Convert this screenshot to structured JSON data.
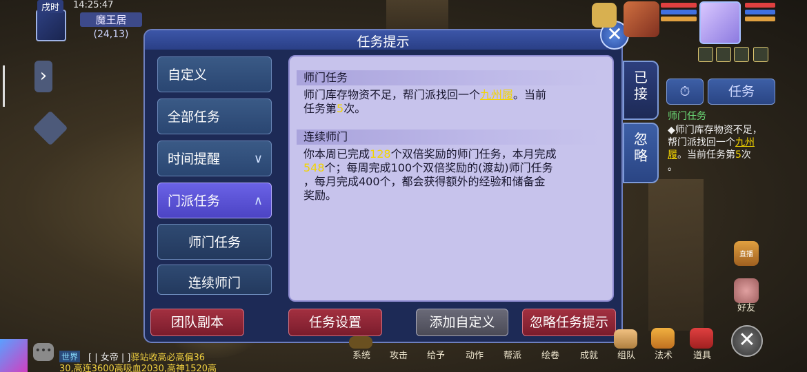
{
  "location": {
    "time_period": "戌时",
    "clock": "14:25:47",
    "map_name": "魔王居",
    "coordinates": "(24,13)"
  },
  "dialog": {
    "title": "任务提示",
    "close_glyph": "✕"
  },
  "menu": {
    "items": [
      {
        "label": "自定义",
        "chevron": ""
      },
      {
        "label": "全部任务",
        "chevron": ""
      },
      {
        "label": "时间提醒",
        "chevron": "∨"
      },
      {
        "label": "门派任务",
        "chevron": "∧"
      },
      {
        "label": "师门任务",
        "chevron": ""
      },
      {
        "label": "连续师门",
        "chevron": ""
      }
    ],
    "active_index": 3
  },
  "content": {
    "sections": [
      {
        "heading": "师门任务",
        "line1_pre": "师门库存物资不足，帮门派找回一个",
        "line1_link": "九州履",
        "line1_post": "。当前",
        "line2_pre": "任务第",
        "line2_num": "5",
        "line2_post": "次。"
      },
      {
        "heading": "连续师门",
        "line1_pre": "你本周已完成",
        "line1_num": "128",
        "line1_post": "个双倍奖励的师门任务，本月完成",
        "line2_num": "548",
        "line2_post": "个；每周完成100个双倍奖励的(渡劫)师门任务",
        "line3": "，每月完成400个，都会获得额外的经验和储备金",
        "line4": "奖励。"
      }
    ]
  },
  "side_tabs": [
    {
      "label": "已\n接"
    },
    {
      "label": "忽\n略"
    }
  ],
  "buttons": {
    "team_dungeon": "团队副本",
    "task_settings": "任务设置",
    "add_custom": "添加自定义",
    "ignore_tips": "忽略任务提示"
  },
  "hud_right": {
    "timer_glyph": "⏱",
    "task_label": "任务",
    "task_title": "师门任务",
    "task_text_pre": "◆师门库存物资不足，帮门派找回一个",
    "task_text_link": "九州履",
    "task_text_mid": "。当前任务第",
    "task_text_num": "5",
    "task_text_post": "次",
    "trailing": "。",
    "live_label": "直播",
    "friends_label": "好友"
  },
  "bottom_menu": [
    "系统",
    "攻击",
    "给予",
    "动作",
    "帮派",
    "绘卷",
    "成就",
    "组队",
    "法术",
    "道具"
  ],
  "chat": {
    "channel": "世界",
    "line1_pre": "[ | 女帝 | ]",
    "line1_msg": "驿站收高必高偏36",
    "line2": "30,高连3600高吸血2030,高神1520高"
  },
  "colors": {
    "dialog_bg": "#1d2a56",
    "content_bg": "#c7c3ec",
    "menu_active": "#5a52d6",
    "button_red": "#8f2636",
    "highlight": "#f2d400",
    "hud_task_green": "#6ee07a"
  }
}
